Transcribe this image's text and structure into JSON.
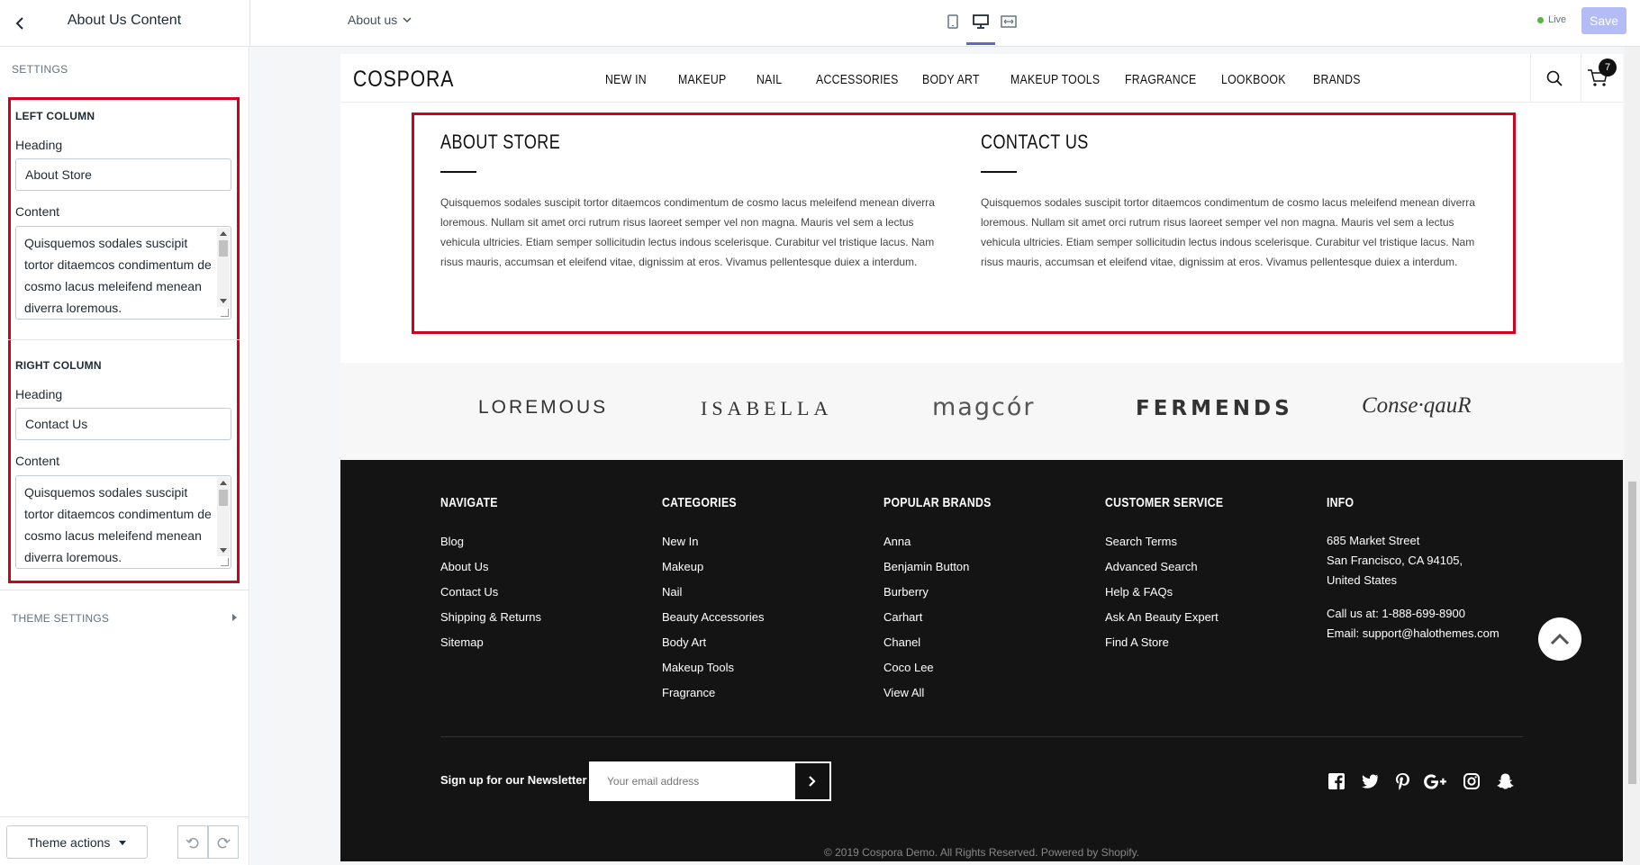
{
  "topbar": {
    "panel_title": "About Us Content",
    "page_select": "About us",
    "live_label": "Live",
    "save_label": "Save"
  },
  "sidebar": {
    "settings_label": "SETTINGS",
    "left_column": {
      "title": "LEFT COLUMN",
      "heading_label": "Heading",
      "heading_value": "About Store",
      "content_label": "Content",
      "content_value": "Quisquemos sodales suscipit tortor ditaemcos condimentum de cosmo lacus meleifend menean diverra loremous."
    },
    "right_column": {
      "title": "RIGHT COLUMN",
      "heading_label": "Heading",
      "heading_value": "Contact Us",
      "content_label": "Content",
      "content_value": "Quisquemos sodales suscipit tortor ditaemcos condimentum de cosmo lacus meleifend menean diverra loremous."
    },
    "theme_settings": "THEME SETTINGS",
    "theme_actions": "Theme actions"
  },
  "store": {
    "logo": "COSPORA",
    "nav": [
      "NEW IN",
      "MAKEUP",
      "NAIL",
      "ACCESSORIES",
      "BODY ART",
      "MAKEUP TOOLS",
      "FRAGRANCE",
      "LOOKBOOK",
      "BRANDS"
    ],
    "cart_count": "7",
    "about": {
      "left_heading": "ABOUT STORE",
      "left_body": "Quisquemos sodales suscipit tortor ditaemcos condimentum de cosmo lacus meleifend menean diverra loremous. Nullam sit amet orci rutrum risus laoreet semper vel non magna. Mauris vel sem a lectus vehicula ultricies. Etiam semper sollicitudin lectus indous scelerisque. Curabitur vel tristique lacus. Nam risus mauris, accumsan et eleifend vitae, dignissim at eros. Vivamus pellentesque duiex a interdum.",
      "right_heading": "CONTACT US",
      "right_body": "Quisquemos sodales suscipit tortor ditaemcos condimentum de cosmo lacus meleifend menean diverra loremous. Nullam sit amet orci rutrum risus laoreet semper vel non magna. Mauris vel sem a lectus vehicula ultricies. Etiam semper sollicitudin lectus indous scelerisque. Curabitur vel tristique lacus. Nam risus mauris, accumsan et eleifend vitae, dignissim at eros. Vivamus pellentesque duiex a interdum."
    },
    "brands": [
      "LOREMOUS",
      "ISABELLA",
      "magcór",
      "FERMENDS",
      "Conse·qauR"
    ],
    "footer": {
      "navigate": {
        "title": "NAVIGATE",
        "links": [
          "Blog",
          "About Us",
          "Contact Us",
          "Shipping & Returns",
          "Sitemap"
        ]
      },
      "categories": {
        "title": "CATEGORIES",
        "links": [
          "New In",
          "Makeup",
          "Nail",
          "Beauty Accessories",
          "Body Art",
          "Makeup Tools",
          "Fragrance"
        ]
      },
      "brands": {
        "title": "POPULAR BRANDS",
        "links": [
          "Anna",
          "Benjamin Button",
          "Burberry",
          "Carhart",
          "Chanel",
          "Coco Lee",
          "View All"
        ]
      },
      "service": {
        "title": "CUSTOMER SERVICE",
        "links": [
          "Search Terms",
          "Advanced Search",
          "Help & FAQs",
          "Ask An Beauty Expert",
          "Find A Store"
        ]
      },
      "info": {
        "title": "INFO",
        "address_1": "685 Market Street",
        "address_2": "San Francisco, CA 94105,",
        "address_3": "United States",
        "phone": "Call us at: 1-888-699-8900",
        "email": "Email: support@halothemes.com"
      },
      "newsletter_label": "Sign up for our Newsletter",
      "newsletter_placeholder": "Your email address",
      "social_icons": [
        "facebook-icon",
        "twitter-icon",
        "pinterest-icon",
        "google-plus-icon",
        "instagram-icon",
        "snapchat-icon"
      ],
      "copyright": "© 2019 Cospora Demo. All Rights Reserved. Powered by Shopify."
    }
  },
  "colors": {
    "highlight": "#d0021b",
    "save_button": "#b3bcf5",
    "accent": "#5c6ac4",
    "live_dot": "#50b83c",
    "footer_bg": "#141414"
  }
}
